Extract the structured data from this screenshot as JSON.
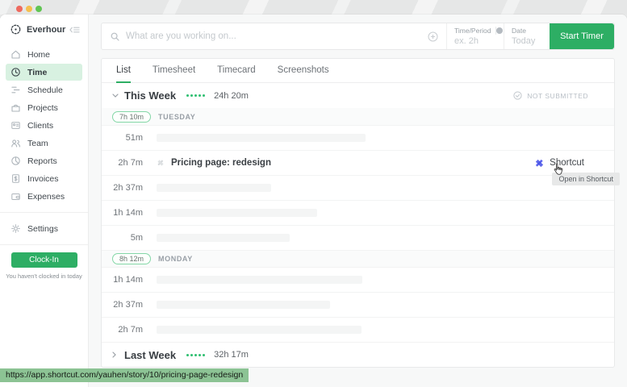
{
  "window": {
    "status_url": "https://app.shortcut.com/yauhen/story/10/pricing-page-redesign"
  },
  "sidebar": {
    "brand": "Everhour",
    "items": [
      {
        "label": "Home"
      },
      {
        "label": "Time",
        "active": true
      },
      {
        "label": "Schedule"
      },
      {
        "label": "Projects"
      },
      {
        "label": "Clients"
      },
      {
        "label": "Team"
      },
      {
        "label": "Reports"
      },
      {
        "label": "Invoices"
      },
      {
        "label": "Expenses"
      }
    ],
    "settings_label": "Settings",
    "clock_in_label": "Clock-In",
    "clock_in_note": "You haven't clocked in today"
  },
  "toolbar": {
    "search_placeholder": "What are you working on...",
    "time_period_label": "Time/Period",
    "time_placeholder": "ex. 2h",
    "date_label": "Date",
    "date_value": "Today",
    "start_timer_label": "Start Timer"
  },
  "tabs": {
    "items": [
      {
        "label": "List",
        "active": true
      },
      {
        "label": "Timesheet"
      },
      {
        "label": "Timecard"
      },
      {
        "label": "Screenshots"
      }
    ]
  },
  "list": {
    "this_week": {
      "title": "This Week",
      "total": "24h 20m",
      "status": "NOT SUBMITTED"
    },
    "last_week": {
      "title": "Last Week",
      "total": "32h 17m"
    },
    "days": [
      {
        "badge": "7h 10m",
        "label": "TUESDAY",
        "rows": [
          {
            "time": "51m",
            "bar": 259
          },
          {
            "time": "2h 7m",
            "title": "Pricing page: redesign",
            "link_label": "Shortcut",
            "tooltip": "Open in Shortcut"
          },
          {
            "time": "2h 37m",
            "bar": 142
          },
          {
            "time": "1h 14m",
            "bar": 199
          },
          {
            "time": "5m",
            "bar": 165
          }
        ]
      },
      {
        "badge": "8h 12m",
        "label": "MONDAY",
        "rows": [
          {
            "time": "1h 14m",
            "bar": 255
          },
          {
            "time": "2h 37m",
            "bar": 215
          },
          {
            "time": "2h 7m",
            "bar": 254
          }
        ]
      }
    ]
  },
  "colors": {
    "accent_green": "#2dae64",
    "active_item_bg": "#d8f1e1",
    "badge_border": "#84d7a7",
    "shortcut_blue": "#5b63ee",
    "status_url_bg": "#8cc394"
  }
}
